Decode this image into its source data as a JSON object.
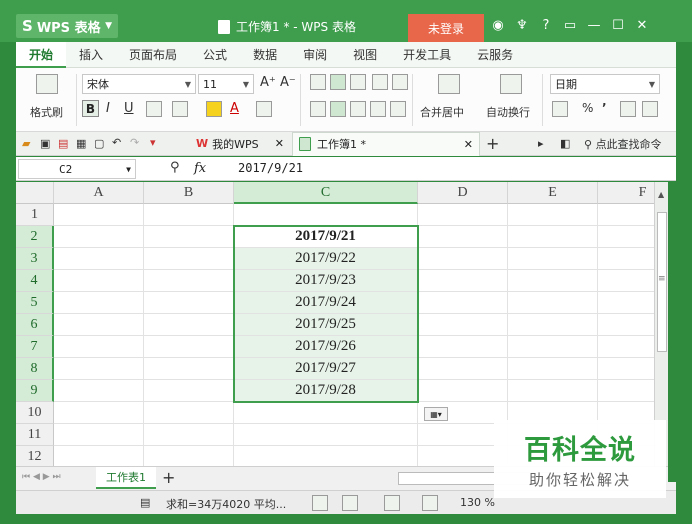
{
  "app": {
    "badge": "WPS 表格",
    "window_title": "工作簿1 * - WPS 表格",
    "login_label": "未登录",
    "help_label": "?"
  },
  "menu": {
    "tabs": [
      "开始",
      "插入",
      "页面布局",
      "公式",
      "数据",
      "审阅",
      "视图",
      "开发工具",
      "云服务"
    ],
    "active": "开始"
  },
  "ribbon": {
    "format_painter": "格式刷",
    "font_name": "宋体",
    "font_size": "11",
    "bold": "B",
    "italic": "I",
    "underline": "U",
    "merge_center": "合并居中",
    "wrap_text": "自动换行",
    "number_format": "日期",
    "percent": "%",
    "comma": "’"
  },
  "doctabs": {
    "mywps": "我的WPS",
    "workbook": "工作簿1 *",
    "search_cmd": "点此查找命令"
  },
  "formula_bar": {
    "name_box": "C2",
    "fx": "fx",
    "value": "2017/9/21"
  },
  "grid": {
    "columns": [
      "A",
      "B",
      "C",
      "D",
      "E",
      "F"
    ],
    "rows": [
      "1",
      "2",
      "3",
      "4",
      "5",
      "6",
      "7",
      "8",
      "9",
      "10",
      "11",
      "12"
    ],
    "dates": [
      "2017/9/21",
      "2017/9/22",
      "2017/9/23",
      "2017/9/24",
      "2017/9/25",
      "2017/9/26",
      "2017/9/27",
      "2017/9/28"
    ]
  },
  "sheets": {
    "active": "工作表1",
    "add": "+"
  },
  "status": {
    "summary": "求和=34万4020  平均...",
    "zoom": "130 %"
  },
  "watermark": {
    "title": "百科全说",
    "subtitle": "助你轻松解决"
  },
  "colors": {
    "brand_green": "#3f9e4e",
    "login_orange": "#e8664a",
    "selection_fill": "#e7f3e8"
  }
}
